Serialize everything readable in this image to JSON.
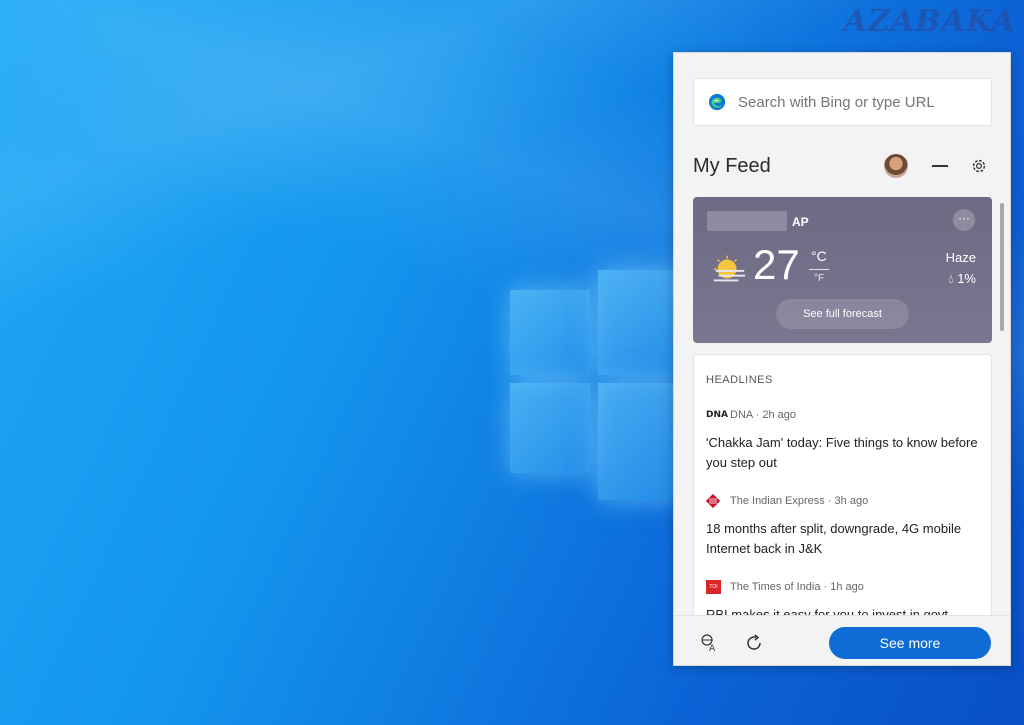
{
  "desktop": {
    "watermark": "AZABAKA"
  },
  "panel": {
    "search": {
      "placeholder": "Search with Bing or type URL",
      "icon": "edge-icon"
    },
    "header": {
      "title": "My Feed",
      "icons": [
        "avatar",
        "minimize-icon",
        "gear-icon"
      ]
    },
    "weather": {
      "location": "AP",
      "more": "···",
      "temperature": "27",
      "unit_c": "°C",
      "unit_f": "°F",
      "condition": "Haze",
      "precipitation": "1%",
      "forecast_button": "See full forecast",
      "icon": "partly-sunny-icon"
    },
    "headlines": {
      "title": "HEADLINES",
      "items": [
        {
          "source_logo": "DNA",
          "source": "DNA · 2h ago",
          "title": "'Chakka Jam' today: Five things to know before you step out"
        },
        {
          "source": "The Indian Express · 3h ago",
          "title": "18 months after split, downgrade, 4G mobile Internet back in J&K"
        },
        {
          "source_logo": "TOI",
          "source": "The Times of India · 1h ago",
          "title": "RBI makes it easy for you to invest in govt"
        }
      ]
    },
    "footer": {
      "see_more": "See more",
      "icons": [
        "language-icon",
        "refresh-icon"
      ]
    }
  }
}
